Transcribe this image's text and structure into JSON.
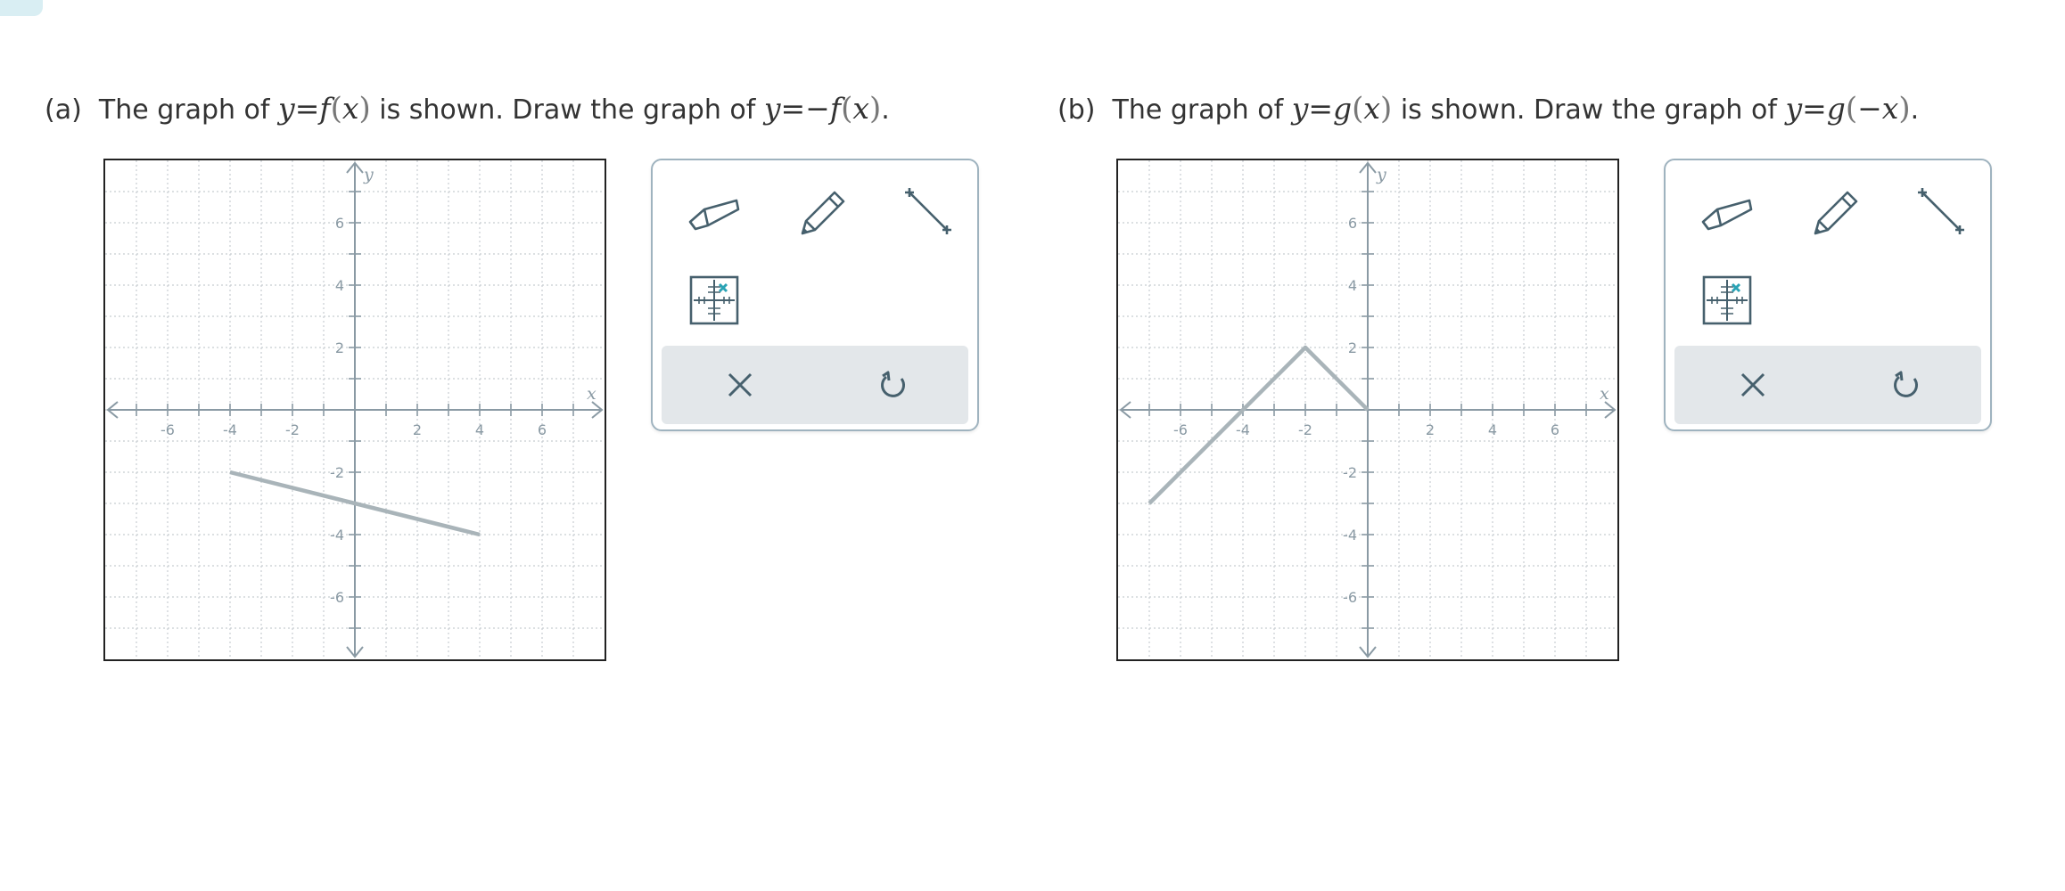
{
  "problems": [
    {
      "label": "(a)",
      "text_pre": "The graph of",
      "given_y": "y",
      "given_eq": "=",
      "given_fn": "f",
      "given_lp": "(",
      "given_arg": "x",
      "given_rp": ")",
      "text_mid": "is shown. Draw the graph of",
      "target_y": "y",
      "target_eq": "=−",
      "target_fn": "f",
      "target_lp": "(",
      "target_arg": "x",
      "target_rp": ")",
      "period": ".",
      "graph": {
        "x_range": [
          -8,
          8
        ],
        "y_range": [
          -8,
          8
        ],
        "x_ticks": [
          -6,
          -4,
          -2,
          2,
          4,
          6
        ],
        "y_ticks": [
          6,
          4,
          2,
          -2,
          -4,
          -6
        ],
        "x_label": "x",
        "y_label": "y",
        "line_points": [
          [
            -4,
            -2
          ],
          [
            4,
            -4
          ]
        ]
      }
    },
    {
      "label": "(b)",
      "text_pre": "The graph of",
      "given_y": "y",
      "given_eq": "=",
      "given_fn": "g",
      "given_lp": "(",
      "given_arg": "x",
      "given_rp": ")",
      "text_mid": "is shown. Draw the graph of",
      "target_y": "y",
      "target_eq": "=",
      "target_fn": "g",
      "target_lp": "(",
      "target_arg": "−x",
      "target_rp": ")",
      "period": ".",
      "graph": {
        "x_range": [
          -8,
          8
        ],
        "y_range": [
          -8,
          8
        ],
        "x_ticks": [
          -6,
          -4,
          -2,
          2,
          4,
          6
        ],
        "y_ticks": [
          6,
          4,
          2,
          -2,
          -4,
          -6
        ],
        "x_label": "x",
        "y_label": "y",
        "line_points": [
          [
            -7,
            -3
          ],
          [
            -2,
            2
          ],
          [
            0,
            0
          ]
        ]
      }
    }
  ],
  "tools": {
    "eraser": "eraser-icon",
    "pencil": "pencil-icon",
    "segment": "line-segment-icon",
    "point": "plot-point-icon",
    "clear": "clear-icon",
    "undo": "undo-icon"
  },
  "colors": {
    "accent": "#2aa3b5",
    "icon": "#46606d",
    "axis": "#8a9aa4",
    "grid": "#c7cdd1",
    "line": "#a9b4b9",
    "bar": "#e3e7ea"
  }
}
